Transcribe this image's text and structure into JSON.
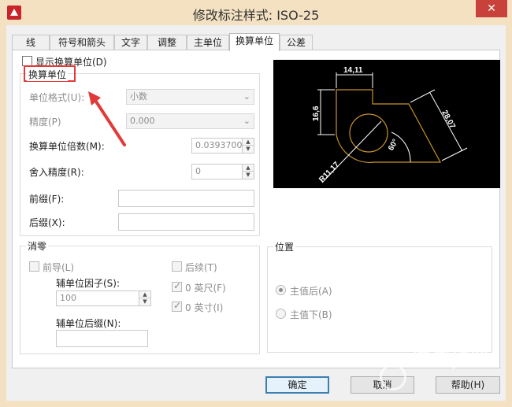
{
  "window": {
    "title": "修改标注样式: ISO-25",
    "close": "✕"
  },
  "tabs": [
    {
      "label": "线"
    },
    {
      "label": "符号和箭头"
    },
    {
      "label": "文字"
    },
    {
      "label": "调整"
    },
    {
      "label": "主单位"
    },
    {
      "label": "换算单位"
    },
    {
      "label": "公差"
    }
  ],
  "active_tab": "换算单位",
  "alt_units": {
    "display_checkbox": "显示换算单位(D)",
    "group_title": "换算单位",
    "unit_format_label": "单位格式(U):",
    "unit_format_value": "小数",
    "precision_label": "精度(P)",
    "precision_value": "0.000",
    "multiplier_label": "换算单位倍数(M):",
    "multiplier_value": "0.0393700",
    "round_label": "舍入精度(R):",
    "round_value": "0",
    "prefix_label": "前缀(F):",
    "prefix_value": "",
    "suffix_label": "后缀(X):",
    "suffix_value": ""
  },
  "zero_suppression": {
    "title": "消零",
    "leading": "前导(L)",
    "sub_unit_factor_label": "辅单位因子(S):",
    "sub_unit_factor_value": "100",
    "sub_unit_suffix_label": "辅单位后缀(N):",
    "sub_unit_suffix_value": "",
    "trailing": "后续(T)",
    "feet": "0 英尺(F)",
    "inches": "0 英寸(I)"
  },
  "placement": {
    "title": "位置",
    "after_primary": "主值后(A)",
    "below_primary": "主值下(B)",
    "selected": "主值后(A)"
  },
  "preview": {
    "dim_top": "14,11",
    "dim_left": "16,6",
    "dim_right": "28,07",
    "dim_angle": "60°",
    "dim_radius": "R11,17"
  },
  "buttons": {
    "ok": "确定",
    "cancel": "取消",
    "help": "帮助(H)"
  },
  "watermark": {
    "text": "搜狗指南",
    "sub": "zhinan.sogou.com"
  },
  "colors": {
    "title_bar": "#f3e1c2",
    "close_button": "#c8413b",
    "highlight_box": "#e23a3a",
    "arrow": "#e23a3a",
    "preview_bg": "#000000",
    "preview_outline": "#c8922a",
    "preview_dims": "#ffffff"
  }
}
